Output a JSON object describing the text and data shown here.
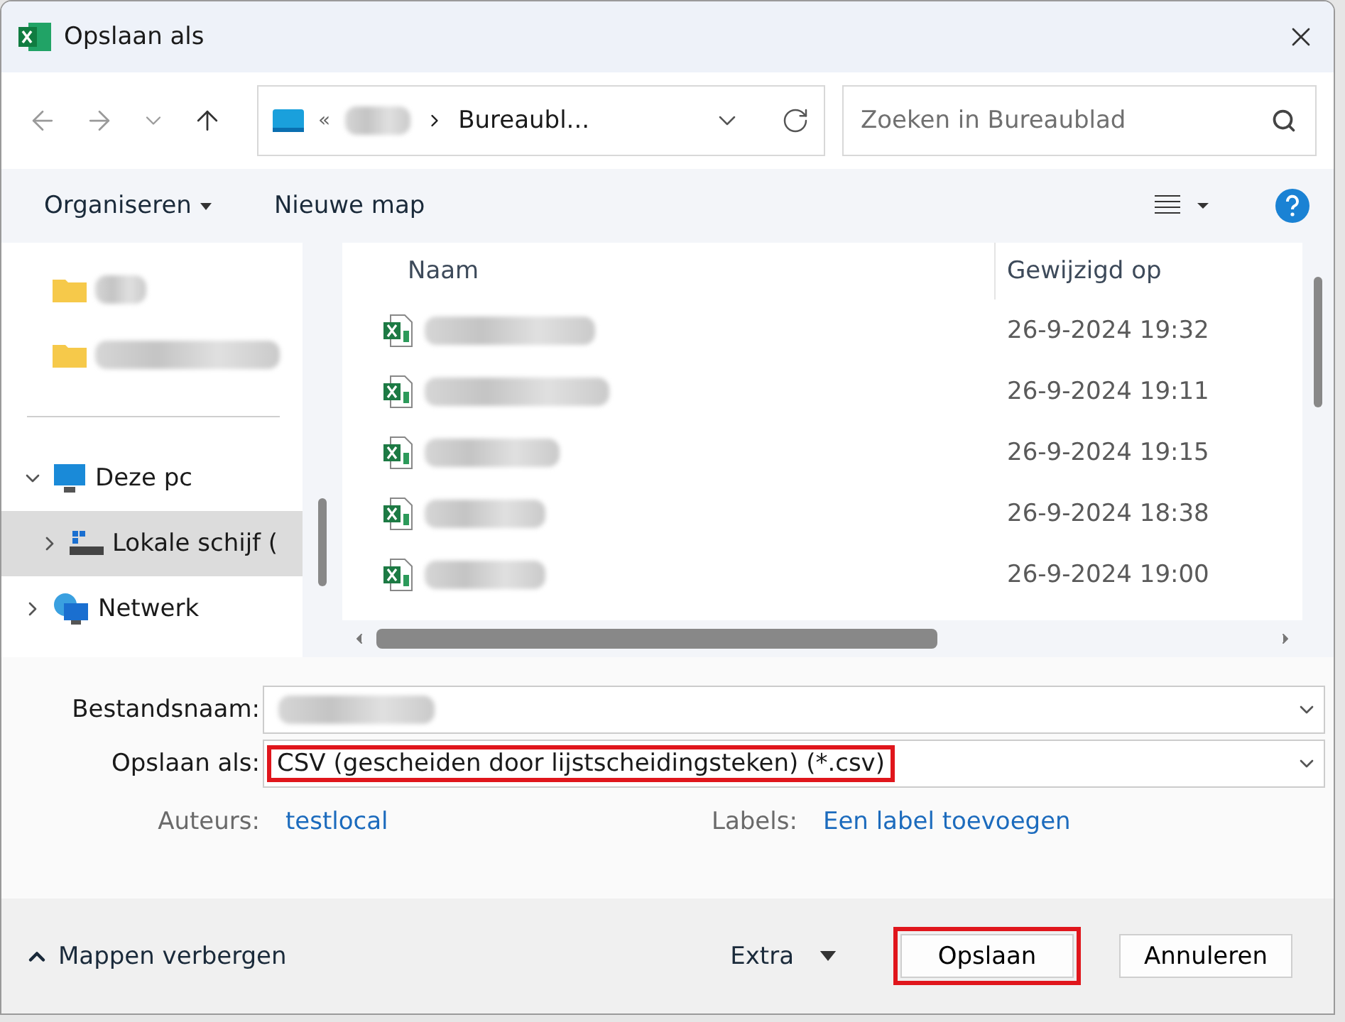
{
  "window": {
    "title": "Opslaan als"
  },
  "nav": {
    "path_prefix": "«",
    "path_current": "Bureaubl...",
    "search": {
      "placeholder": "Zoeken in Bureaublad"
    }
  },
  "toolbar": {
    "organize": "Organiseren",
    "new_folder": "Nieuwe map"
  },
  "sidebar": {
    "items": [
      {
        "kind": "folder",
        "selected": false
      },
      {
        "kind": "folder",
        "selected": false
      },
      {
        "kind": "divider"
      },
      {
        "kind": "pc",
        "label": "Deze pc",
        "expanded": true,
        "selected": false,
        "children": [
          {
            "kind": "drive",
            "label": "Lokale schijf (",
            "expanded": false,
            "selected": true
          }
        ]
      },
      {
        "kind": "network",
        "label": "Netwerk",
        "expanded": false,
        "selected": false
      }
    ]
  },
  "table": {
    "columns": [
      "Naam",
      "Gewijzigd op"
    ],
    "rows": [
      {
        "modified": "26-9-2024 19:32"
      },
      {
        "modified": "26-9-2024 19:11"
      },
      {
        "modified": "26-9-2024 19:15"
      },
      {
        "modified": "26-9-2024 18:38"
      },
      {
        "modified": "26-9-2024 19:00"
      }
    ]
  },
  "form": {
    "filename_label": "Bestandsnaam:",
    "filetype_label": "Opslaan als:",
    "filetype_value": "CSV (gescheiden door lijstscheidingsteken) (*.csv)",
    "filetype_highlighted": true,
    "authors_label": "Auteurs:",
    "authors_value": "testlocal",
    "tags_label": "Labels:",
    "tags_value": "Een label toevoegen"
  },
  "footer": {
    "hide_folders": "Mappen verbergen",
    "tools": "Extra",
    "save": {
      "label": "Opslaan",
      "highlighted": true
    },
    "cancel": "Annuleren"
  }
}
